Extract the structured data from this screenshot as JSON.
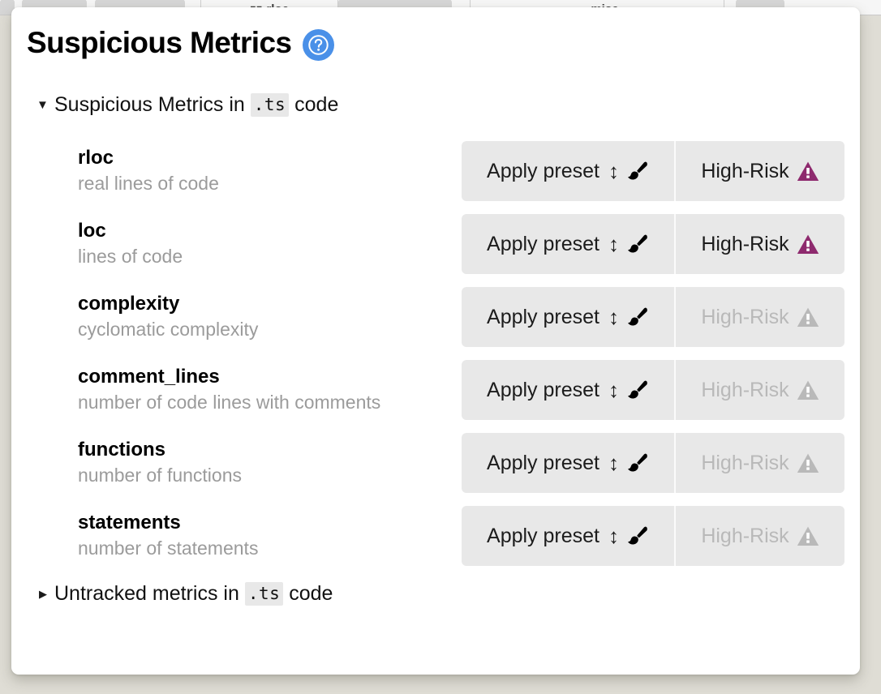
{
  "backdrop": {
    "toolbar_items": [
      {
        "name": "toolbar-chunk-1",
        "label": ""
      },
      {
        "name": "toolbar-chunk-2",
        "label": ""
      },
      {
        "name": "toolbar-label-rloc",
        "label": "rloc",
        "glyph": "columns-icon"
      },
      {
        "name": "toolbar-chunk-3",
        "label": ""
      },
      {
        "name": "toolbar-label-misc",
        "label": "misc",
        "glyph": "chevron-down-icon"
      },
      {
        "name": "toolbar-chunk-4",
        "label": ""
      }
    ]
  },
  "header": {
    "title": "Suspicious Metrics",
    "help_icon": "question-mark-circle-icon",
    "help_icon_color": "#4a90e8"
  },
  "sections": {
    "open": {
      "twisty": "▼",
      "text_before": "Suspicious Metrics in",
      "code": ".ts",
      "text_after": "code",
      "expanded": "true"
    },
    "closed": {
      "twisty": "▶",
      "text_before": "Untracked metrics in",
      "code": ".ts",
      "text_after": "code",
      "expanded": "false"
    }
  },
  "buttons": {
    "preset_label": "Apply preset",
    "preset_updown_glyph": "↕",
    "preset_brush_icon": "paintbrush-icon",
    "risk_label": "High-Risk",
    "risk_icon": "warning-triangle-icon",
    "risk_active_color": "#8e2a6e",
    "risk_disabled_color": "#b9b9b9",
    "segment_background": "#e8e8e8"
  },
  "metrics": [
    {
      "name": "rloc",
      "description": "real lines of code",
      "preset_label": "Apply preset",
      "risk_label": "High-Risk",
      "risk_active": true
    },
    {
      "name": "loc",
      "description": "lines of code",
      "preset_label": "Apply preset",
      "risk_label": "High-Risk",
      "risk_active": true
    },
    {
      "name": "complexity",
      "description": "cyclomatic complexity",
      "preset_label": "Apply preset",
      "risk_label": "High-Risk",
      "risk_active": false
    },
    {
      "name": "comment_lines",
      "description": "number of code lines with comments",
      "preset_label": "Apply preset",
      "risk_label": "High-Risk",
      "risk_active": false
    },
    {
      "name": "functions",
      "description": "number of functions",
      "preset_label": "Apply preset",
      "risk_label": "High-Risk",
      "risk_active": false
    },
    {
      "name": "statements",
      "description": "number of statements",
      "preset_label": "Apply preset",
      "risk_label": "High-Risk",
      "risk_active": false
    }
  ]
}
